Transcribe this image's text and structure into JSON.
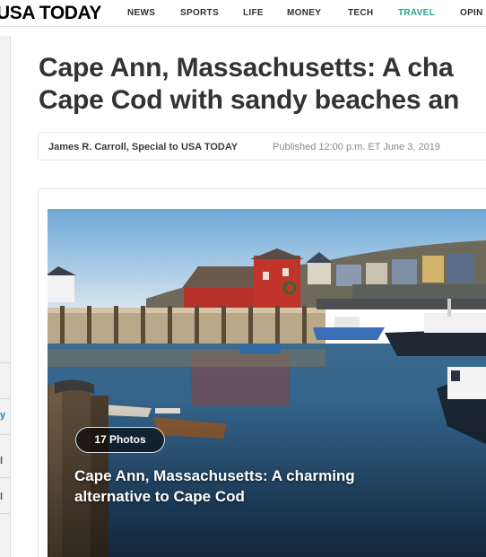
{
  "site": {
    "brand": "USA TODAY"
  },
  "nav": {
    "items": [
      {
        "label": "NEWS",
        "active": false
      },
      {
        "label": "SPORTS",
        "active": false
      },
      {
        "label": "LIFE",
        "active": false
      },
      {
        "label": "MONEY",
        "active": false
      },
      {
        "label": "TECH",
        "active": false
      },
      {
        "label": "TRAVEL",
        "active": true
      },
      {
        "label": "OPIN",
        "active": false
      }
    ]
  },
  "article": {
    "headline_line1": "Cape Ann, Massachusetts: A cha",
    "headline_line2": "Cape Cod with sandy beaches an",
    "author": "James R. Carroll, Special to USA TODAY",
    "published": "Published 12:00 p.m. ET June 3, 2019"
  },
  "gallery": {
    "photos_label": "17 Photos",
    "caption": "Cape Ann, Massachusetts: A charming alternative to Cape Cod"
  },
  "left_rail": {
    "marks": [
      "y",
      "l",
      "l"
    ]
  },
  "colors": {
    "accent": "#27a096",
    "headline": "#333333",
    "byline_meta": "#8a8a8a",
    "barn_red": "#b8302a",
    "water": "#2f5d86"
  }
}
